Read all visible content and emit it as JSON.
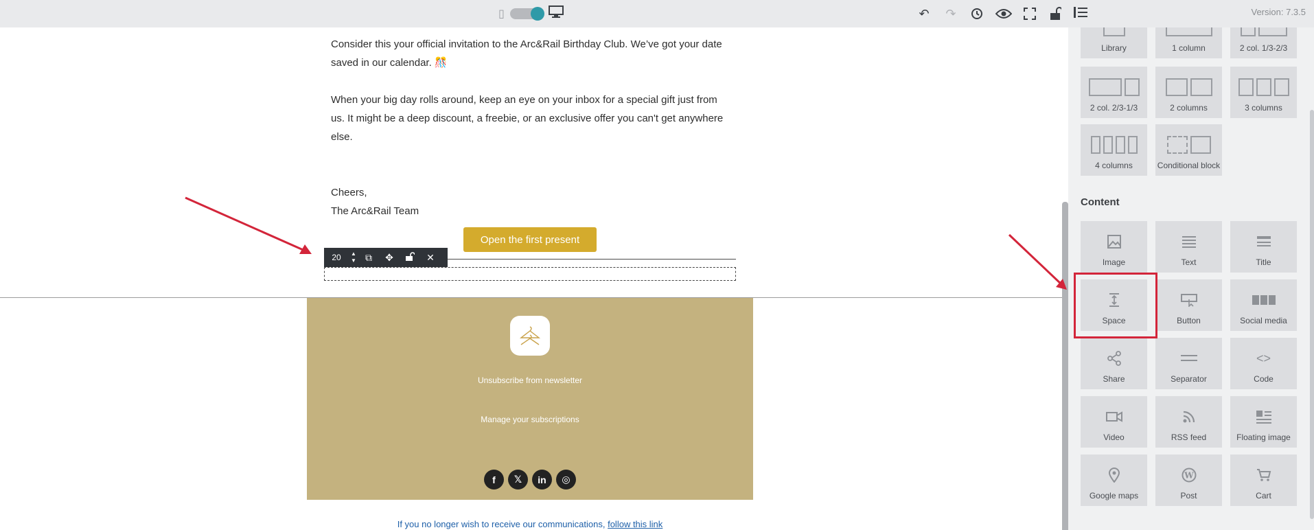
{
  "topbar": {
    "version": "Version: 7.3.5"
  },
  "email": {
    "paragraphs": [
      "Consider this your official invitation to the Arc&Rail Birthday Club. We’ve got your date saved in our calendar. 🎊",
      "When your big day rolls around, keep an eye on your inbox for a special gift just from us. It might be a deep discount, a freebie, or an exclusive offer you can't get anywhere else."
    ],
    "signoff": "Cheers,",
    "signature": "The Arc&Rail Team",
    "cta": "Open the first present",
    "space_value": "20",
    "footer": {
      "unsubscribe": "Unsubscribe from newsletter",
      "manage": "Manage your subscriptions"
    },
    "opt_out_text": "If you no longer wish to receive our communications,",
    "opt_out_link": "follow this link"
  },
  "panel": {
    "structure": [
      {
        "label": "Library"
      },
      {
        "label": "1 column"
      },
      {
        "label": "2 col. 1/3-2/3"
      },
      {
        "label": "2 col. 2/3-1/3"
      },
      {
        "label": "2 columns"
      },
      {
        "label": "3 columns"
      },
      {
        "label": "4 columns"
      },
      {
        "label": "Conditional block"
      }
    ],
    "content_title": "Content",
    "content": [
      {
        "label": "Image",
        "icon": "image-icon"
      },
      {
        "label": "Text",
        "icon": "text-icon"
      },
      {
        "label": "Title",
        "icon": "title-icon"
      },
      {
        "label": "Space",
        "icon": "space-icon"
      },
      {
        "label": "Button",
        "icon": "button-icon"
      },
      {
        "label": "Social media",
        "icon": "social-media-icon"
      },
      {
        "label": "Share",
        "icon": "share-icon"
      },
      {
        "label": "Separator",
        "icon": "separator-icon"
      },
      {
        "label": "Code",
        "icon": "code-icon"
      },
      {
        "label": "Video",
        "icon": "video-icon"
      },
      {
        "label": "RSS feed",
        "icon": "rss-icon"
      },
      {
        "label": "Floating image",
        "icon": "floating-image-icon"
      },
      {
        "label": "Google maps",
        "icon": "map-pin-icon"
      },
      {
        "label": "Post",
        "icon": "wordpress-icon"
      },
      {
        "label": "Cart",
        "icon": "cart-icon"
      }
    ]
  },
  "colors": {
    "accent": "#2f9aa8",
    "cta": "#d4ab2d",
    "footer_bg": "#c4b27f",
    "highlight": "#d3253a"
  }
}
